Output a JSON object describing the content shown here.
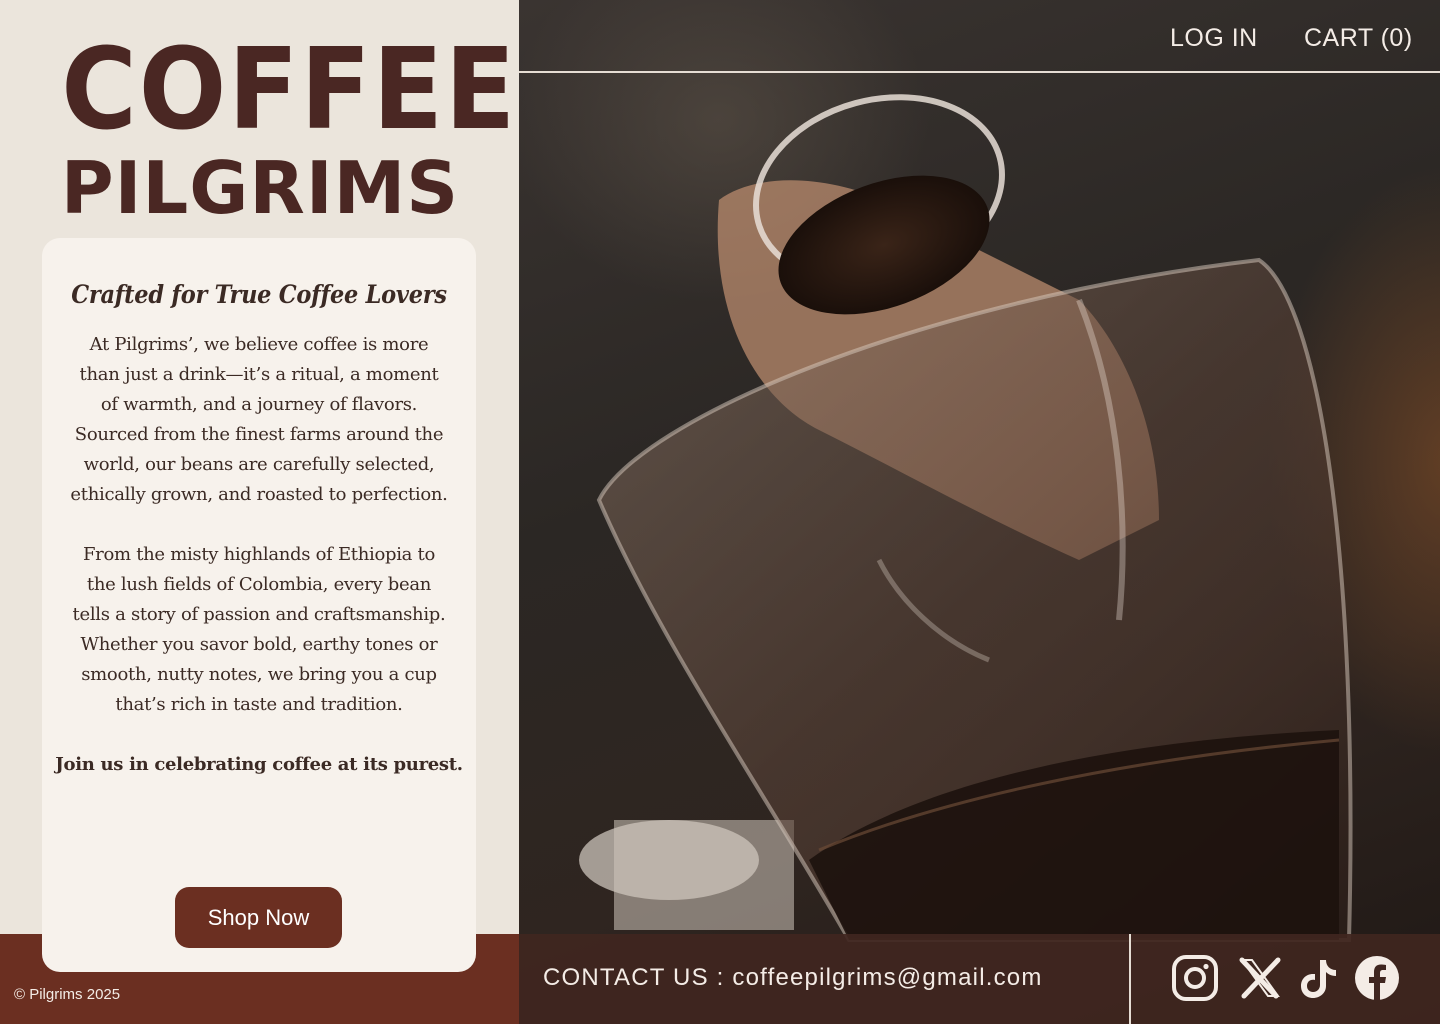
{
  "brand": {
    "line1": "COFFEE",
    "line2": "PILGRIMS"
  },
  "nav": {
    "login": "LOG IN",
    "cart": "CART (0)"
  },
  "intro": {
    "heading": "Crafted for True Coffee Lovers",
    "paragraph1": "At Pilgrims’, we believe coffee is more than just a drink—it’s a ritual, a moment of warmth, and a journey of flavors. Sourced from the finest farms around the world, our beans are carefully selected, ethically grown, and roasted to perfection.",
    "paragraph2": "From the misty highlands of Ethiopia to the lush fields of Colombia, every bean tells a story of passion and craftsmanship. Whether you savor bold, earthy tones or smooth, nutty notes, we bring you a cup that’s rich in taste and tradition.",
    "closing": "Join us in celebrating coffee at its purest.",
    "cta": "Shop Now"
  },
  "footer": {
    "contact": "CONTACT US : coffeepilgrims@gmail.com",
    "copyright": "© Pilgrims 2025",
    "social": [
      "instagram-icon",
      "x-icon",
      "tiktok-icon",
      "facebook-icon"
    ]
  },
  "colors": {
    "brand_brown": "#4a2723",
    "button": "#6b2f21",
    "panel": "#ebe5dc",
    "card": "#f7f2ec"
  }
}
